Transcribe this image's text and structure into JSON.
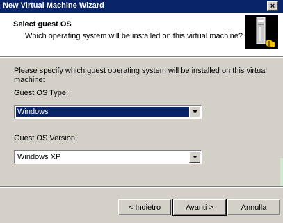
{
  "window": {
    "title": "New Virtual Machine Wizard",
    "close_label": "×"
  },
  "header": {
    "title": "Select guest OS",
    "subtitle": "Which operating system will be installed on this virtual machine?"
  },
  "main": {
    "intro": "Please specify which guest operating system will be installed on this virtual machine:",
    "os_type": {
      "label": "Guest OS Type:",
      "value": "Windows"
    },
    "os_version": {
      "label": "Guest OS Version:",
      "value": "Windows XP"
    }
  },
  "footer": {
    "back_label": "< Indietro",
    "next_label": "Avanti >",
    "cancel_label": "Annulla"
  },
  "icons": {
    "header_graphic": "vm-server-icon",
    "combo_arrow": "chevron-down-icon"
  },
  "colors": {
    "titlebar": "#0a246a",
    "selection": "#0a246a",
    "dialog_bg": "#d4d0c8"
  }
}
